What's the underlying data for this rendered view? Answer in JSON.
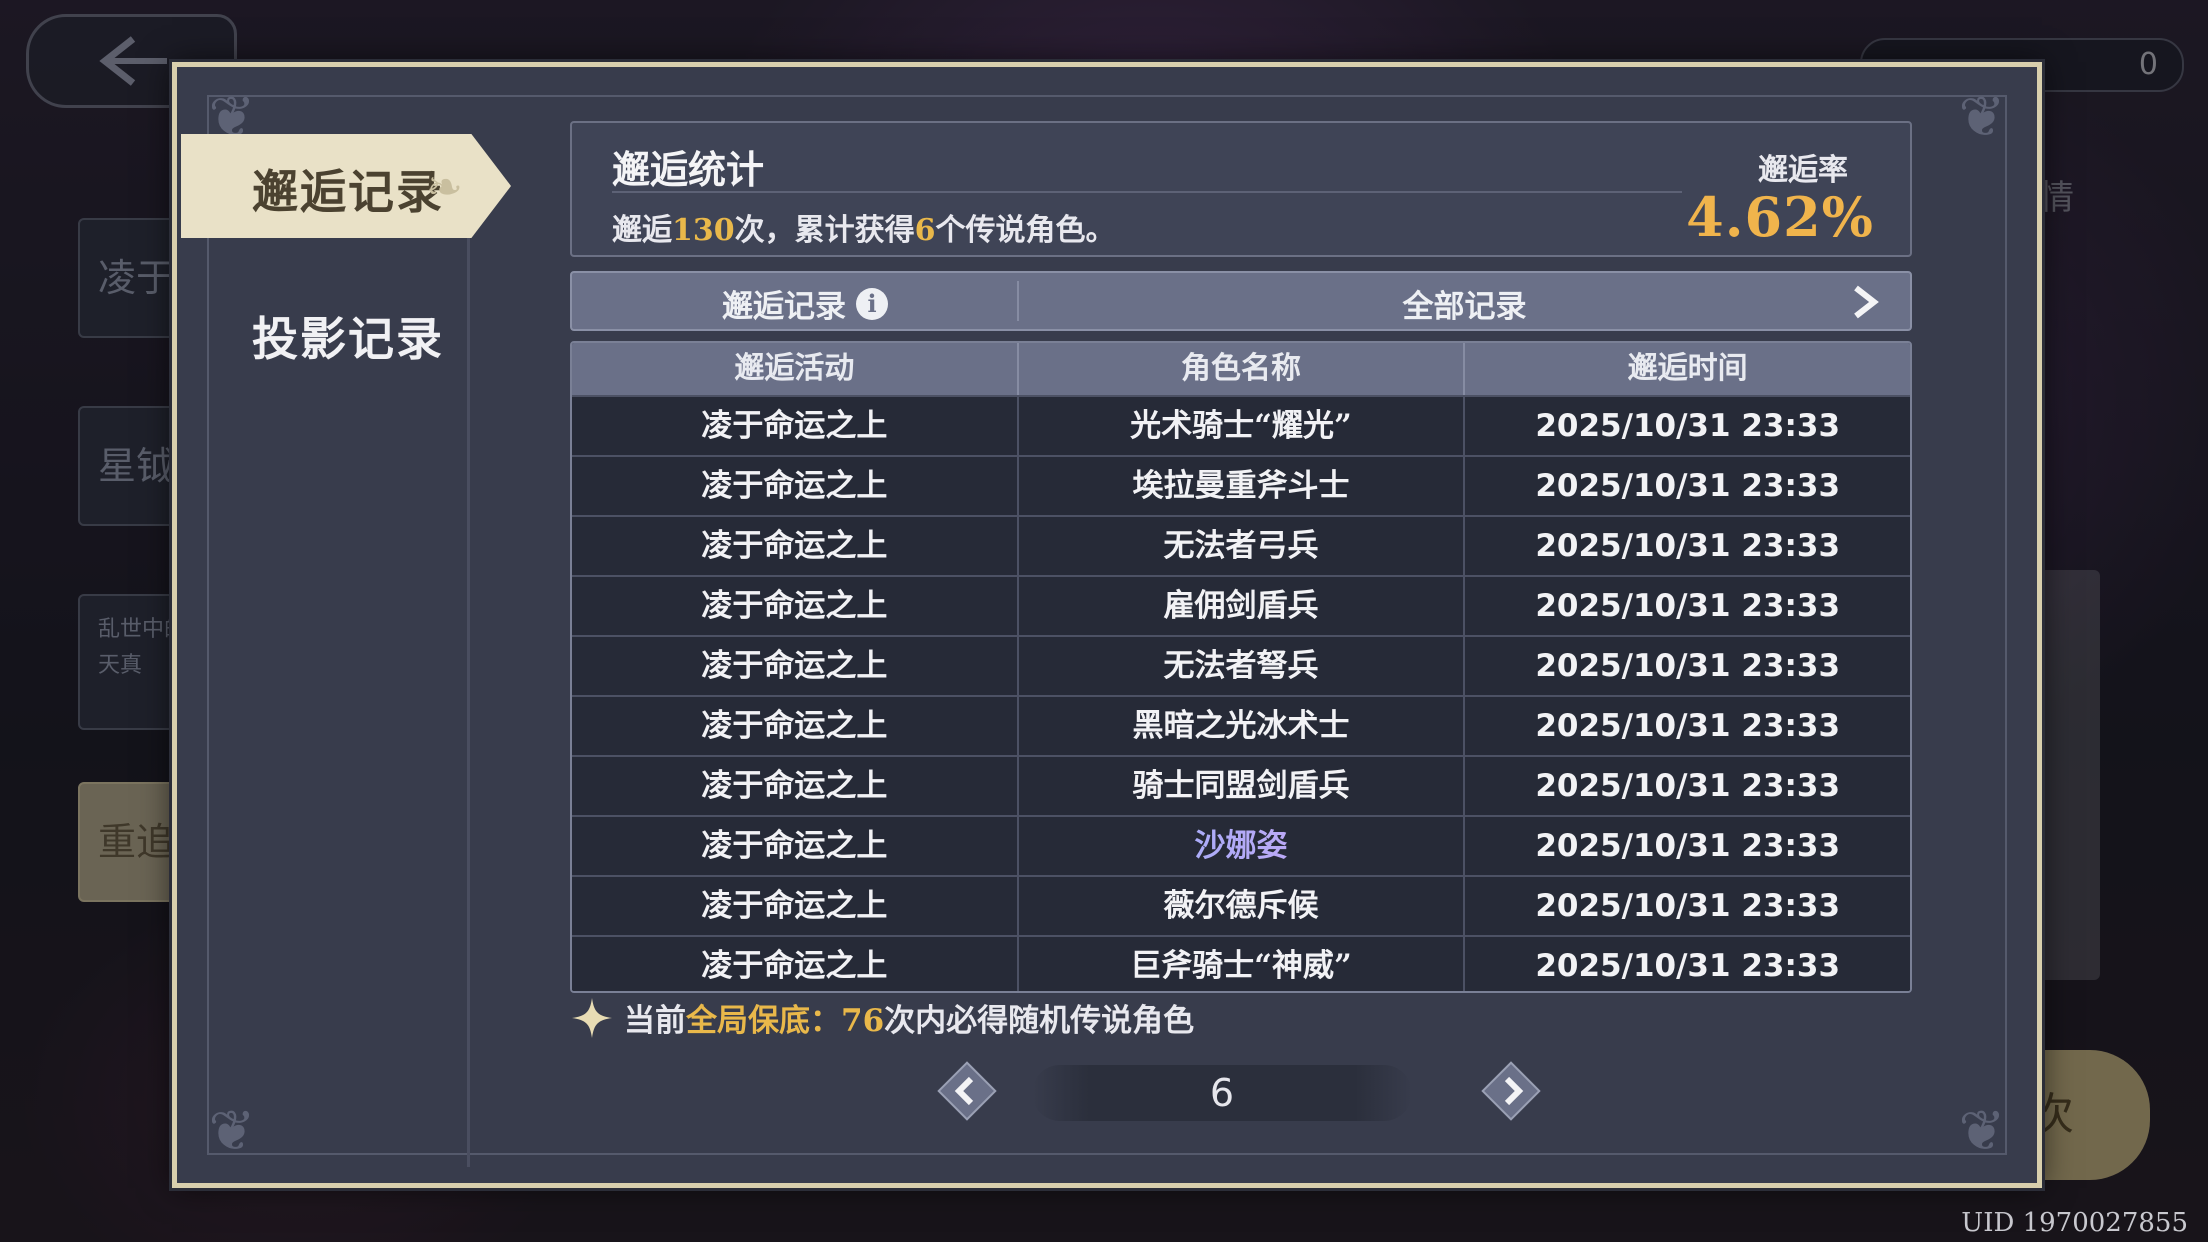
{
  "background": {
    "side_tabs": [
      "凌于",
      "星钺",
      "乱世中的 天真",
      "重追"
    ],
    "right_button": "次",
    "right_side_text": "情",
    "resource_count": "0"
  },
  "uid": "UID 1970027855",
  "nav": {
    "active_label": "邂逅记录",
    "other_label": "投影记录"
  },
  "stats": {
    "title": "邂逅统计",
    "summary_prefix": "邂逅",
    "draws": "130",
    "summary_mid": "次，累计获得",
    "legend_count": "6",
    "summary_suffix": "个传说角色。",
    "rate_label": "邂逅率",
    "rate_value": "4.62%"
  },
  "header_bar": {
    "left_label": "邂逅记录",
    "right_label": "全部记录"
  },
  "table": {
    "columns": [
      "邂逅活动",
      "角色名称",
      "邂逅时间"
    ],
    "rows": [
      {
        "event": "凌于命运之上",
        "name": "光术骑士“耀光”",
        "time": "2025/10/31 23:33",
        "legendary": false
      },
      {
        "event": "凌于命运之上",
        "name": "埃拉曼重斧斗士",
        "time": "2025/10/31 23:33",
        "legendary": false
      },
      {
        "event": "凌于命运之上",
        "name": "无法者弓兵",
        "time": "2025/10/31 23:33",
        "legendary": false
      },
      {
        "event": "凌于命运之上",
        "name": "雇佣剑盾兵",
        "time": "2025/10/31 23:33",
        "legendary": false
      },
      {
        "event": "凌于命运之上",
        "name": "无法者弩兵",
        "time": "2025/10/31 23:33",
        "legendary": false
      },
      {
        "event": "凌于命运之上",
        "name": "黑暗之光冰术士",
        "time": "2025/10/31 23:33",
        "legendary": false
      },
      {
        "event": "凌于命运之上",
        "name": "骑士同盟剑盾兵",
        "time": "2025/10/31 23:33",
        "legendary": false
      },
      {
        "event": "凌于命运之上",
        "name": "沙娜姿",
        "time": "2025/10/31 23:33",
        "legendary": true
      },
      {
        "event": "凌于命运之上",
        "name": "薇尔德斥候",
        "time": "2025/10/31 23:33",
        "legendary": false
      },
      {
        "event": "凌于命运之上",
        "name": "巨斧骑士“神威”",
        "time": "2025/10/31 23:33",
        "legendary": false
      }
    ]
  },
  "pity": {
    "prefix": "当前",
    "highlight": "全局保底：",
    "count": "76",
    "suffix": "次内必得随机传说角色"
  },
  "pager": {
    "page": "6"
  },
  "colors": {
    "accent_gold": "#e9b84a",
    "panel_bg": "#383c4c",
    "frame": "#d8cfad",
    "legend_name": "#b7a6ea"
  }
}
